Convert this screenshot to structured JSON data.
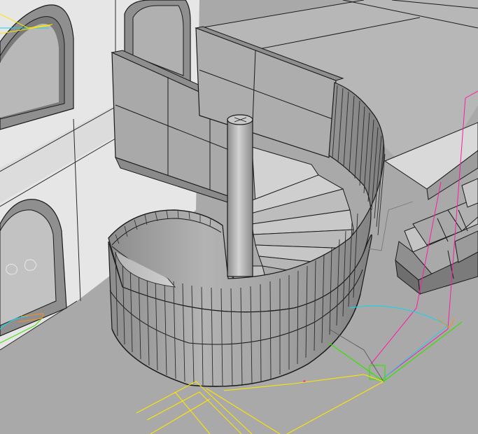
{
  "viewport": {
    "kind": "3D shaded viewport (CAD modeling view)",
    "visible_text": []
  },
  "colors": {
    "background": "#a9a9a9",
    "wall_light": "#e3e3e3",
    "wall_shadow": "#c7c7c7",
    "floor_slab": "#b4b4b4",
    "floor_slab_edge": "#d8d8d8",
    "panel": "#a6a6a6",
    "panel_dark": "#8f8f8f",
    "rail_outer": "#9a9a9a",
    "rail_inner": "#bdbdbd",
    "column": "#b8b8b8",
    "column_shade": "#8e8e8e",
    "edge": "#1a1a1a",
    "annotation_magenta": "#ff1aa8",
    "annotation_yellow": "#ffe600",
    "annotation_green": "#38e000",
    "annotation_cyan": "#19d3e6",
    "annotation_orange": "#ff8c1a"
  },
  "objects": {
    "icons": [
      "arch-window",
      "spiral-staircase",
      "sofa"
    ]
  }
}
